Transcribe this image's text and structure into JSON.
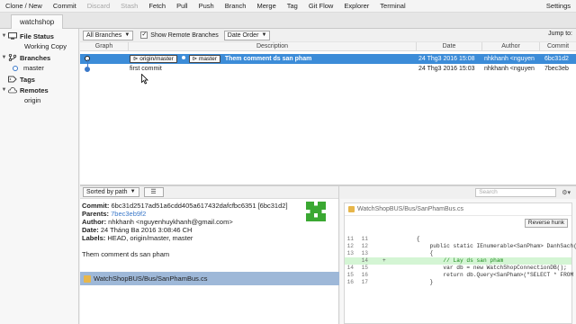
{
  "toolbar": {
    "buttons": [
      "Clone / New",
      "Commit",
      "Discard",
      "Stash",
      "Fetch",
      "Pull",
      "Push",
      "Branch",
      "Merge",
      "Tag",
      "Git Flow",
      "Explorer",
      "Terminal"
    ],
    "settings": "Settings"
  },
  "repo_tab": "watchshop",
  "sidebar": {
    "file_status": "File Status",
    "working_copy": "Working Copy",
    "branches": "Branches",
    "branch_master": "master",
    "tags": "Tags",
    "remotes": "Remotes",
    "remote_origin": "origin"
  },
  "filter": {
    "branches_dropdown": "All Branches",
    "show_remote": "Show Remote Branches",
    "order_dropdown": "Date Order",
    "jump_to": "Jump to:"
  },
  "columns": {
    "graph": "Graph",
    "description": "Description",
    "date": "Date",
    "author": "Author",
    "commit": "Commit"
  },
  "commits": [
    {
      "tags": [
        "origin/master",
        "master"
      ],
      "description": "Them comment ds san pham",
      "date": "24 Thg3 2016 15:08",
      "author": "nhkhanh <nguyen",
      "hash": "6bc31d2"
    },
    {
      "tags": [],
      "description": "first commit",
      "date": "24 Thg3 2016 15:03",
      "author": "nhkhanh <nguyen",
      "hash": "7bec3eb"
    }
  ],
  "file_pane": {
    "sort_dropdown": "Sorted by path",
    "list_button": "☰",
    "commit_label": "Commit:",
    "commit_value": "6bc31d2517ad51a6cdd405a617432dafcfbc6351 [6bc31d2]",
    "parents_label": "Parents:",
    "parents_value": "7bec3eb9f2",
    "author_label": "Author:",
    "author_value": "nhkhanh <nguyenhuykhanh@gmail.com>",
    "date_label": "Date:",
    "date_value": "24 Tháng Ba 2016 3:08:46 CH",
    "labels_label": "Labels:",
    "labels_value": "HEAD, origin/master, master",
    "message": "Them comment ds san pham",
    "changed_file": "WatchShopBUS/Bus/SanPhamBus.cs"
  },
  "diff_pane": {
    "search_placeholder": "Search",
    "file_header": "WatchShopBUS/Bus/SanPhamBus.cs",
    "reverse_hunk": "Reverse hunk",
    "lines": [
      {
        "old": "11",
        "new": "11",
        "sign": "",
        "type": "context",
        "code": "        {"
      },
      {
        "old": "12",
        "new": "12",
        "sign": "",
        "type": "context",
        "code": "            public static IEnumerable<SanPham> DanhSach()"
      },
      {
        "old": "13",
        "new": "13",
        "sign": "",
        "type": "context",
        "code": "            {"
      },
      {
        "old": "",
        "new": "14",
        "sign": "+",
        "type": "added",
        "code": "                // Lay ds san pham"
      },
      {
        "old": "14",
        "new": "15",
        "sign": "",
        "type": "context",
        "code": "                var db = new WatchShopConnectionDB();"
      },
      {
        "old": "15",
        "new": "16",
        "sign": "",
        "type": "context",
        "code": "                return db.Query<SanPham>(\"SELECT * FROM Sa"
      },
      {
        "old": "16",
        "new": "17",
        "sign": "",
        "type": "context",
        "code": "            }"
      }
    ]
  },
  "colors": {
    "selection": "#3c8cd8",
    "added_line": "#d4f5d4",
    "link": "#3a78c9"
  }
}
